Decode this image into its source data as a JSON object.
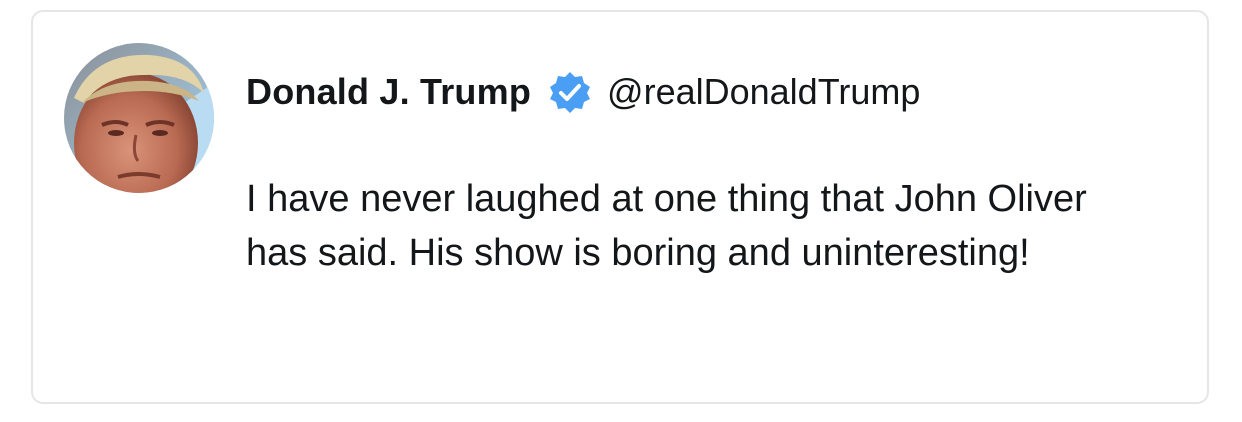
{
  "tweet": {
    "author_name": "Donald J. Trump",
    "handle": "@realDonaldTrump",
    "verified": true,
    "text": "I have never laughed at one thing that John Oliver has said. His show is boring and uninteresting!"
  },
  "icons": {
    "verified": "verified-badge-icon",
    "avatar": "profile-photo"
  },
  "colors": {
    "verified_blue": "#4a9ff5",
    "text": "#14171a",
    "border": "#e6e6e6"
  }
}
